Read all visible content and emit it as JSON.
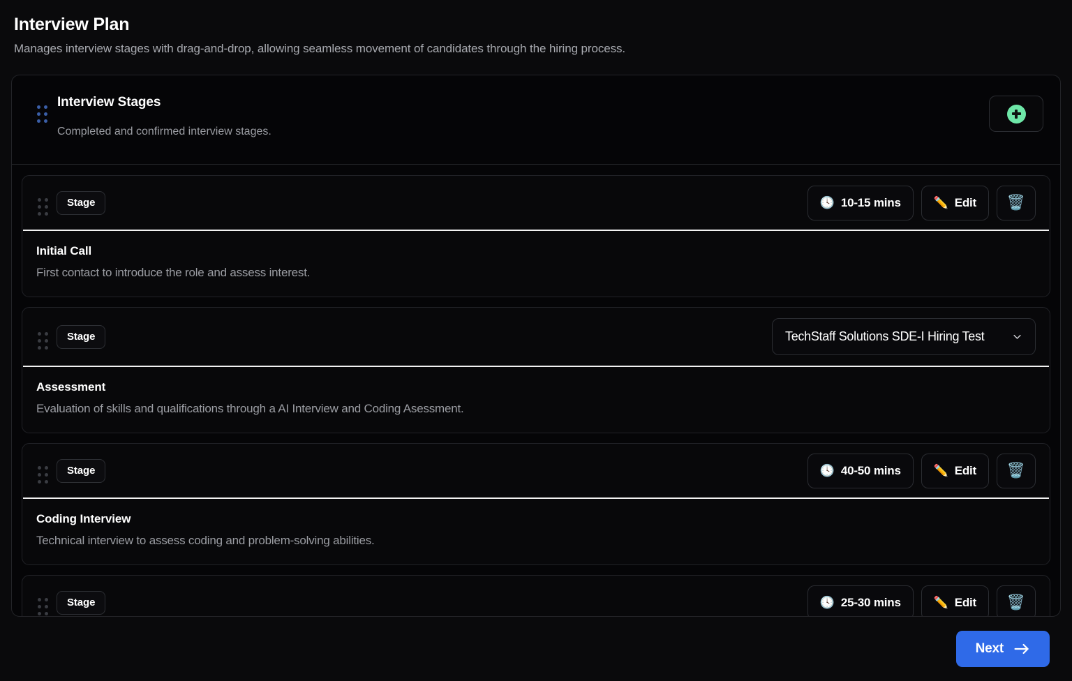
{
  "header": {
    "title": "Interview Plan",
    "subtitle": "Manages interview stages with drag-and-drop, allowing seamless movement of candidates through the hiring process."
  },
  "card": {
    "title": "Interview Stages",
    "subtitle": "Completed and confirmed interview stages.",
    "drag_handle_icon": "drag-handle-icon",
    "add_button": {
      "icon": "plus-circle-icon",
      "label": ""
    }
  },
  "stages": [
    {
      "badge": "Stage",
      "control_type": "duration",
      "duration": "10-15 mins",
      "duration_icon": "clock-icon",
      "edit_label": "Edit",
      "edit_icon": "pencil-icon",
      "delete_icon": "trash-icon",
      "name": "Initial Call",
      "description": "First contact to introduce the role and assess interest."
    },
    {
      "badge": "Stage",
      "control_type": "select",
      "select_value": "TechStaff Solutions SDE-I Hiring Test",
      "select_icon": "chevron-down-icon",
      "name": "Assessment",
      "description": "Evaluation of skills and qualifications through a AI Interview and Coding Asessment."
    },
    {
      "badge": "Stage",
      "control_type": "duration",
      "duration": "40-50 mins",
      "duration_icon": "clock-icon",
      "edit_label": "Edit",
      "edit_icon": "pencil-icon",
      "delete_icon": "trash-icon",
      "name": "Coding Interview",
      "description": "Technical interview to assess coding and problem-solving abilities."
    },
    {
      "badge": "Stage",
      "control_type": "duration",
      "duration": "25-30 mins",
      "duration_icon": "clock-icon",
      "edit_label": "Edit",
      "edit_icon": "pencil-icon",
      "delete_icon": "trash-icon",
      "name": "",
      "description": ""
    }
  ],
  "footer": {
    "next_label": "Next",
    "next_icon": "arrow-right-icon"
  },
  "colors": {
    "page_bg": "#0a0a0c",
    "card_bg": "#050507",
    "accent_blue": "#2f6ae8",
    "accent_green": "#6ee7a8",
    "trash_blue": "#29a3e8",
    "divider": "#f2f2f2",
    "muted_text": "#9b9da3"
  }
}
